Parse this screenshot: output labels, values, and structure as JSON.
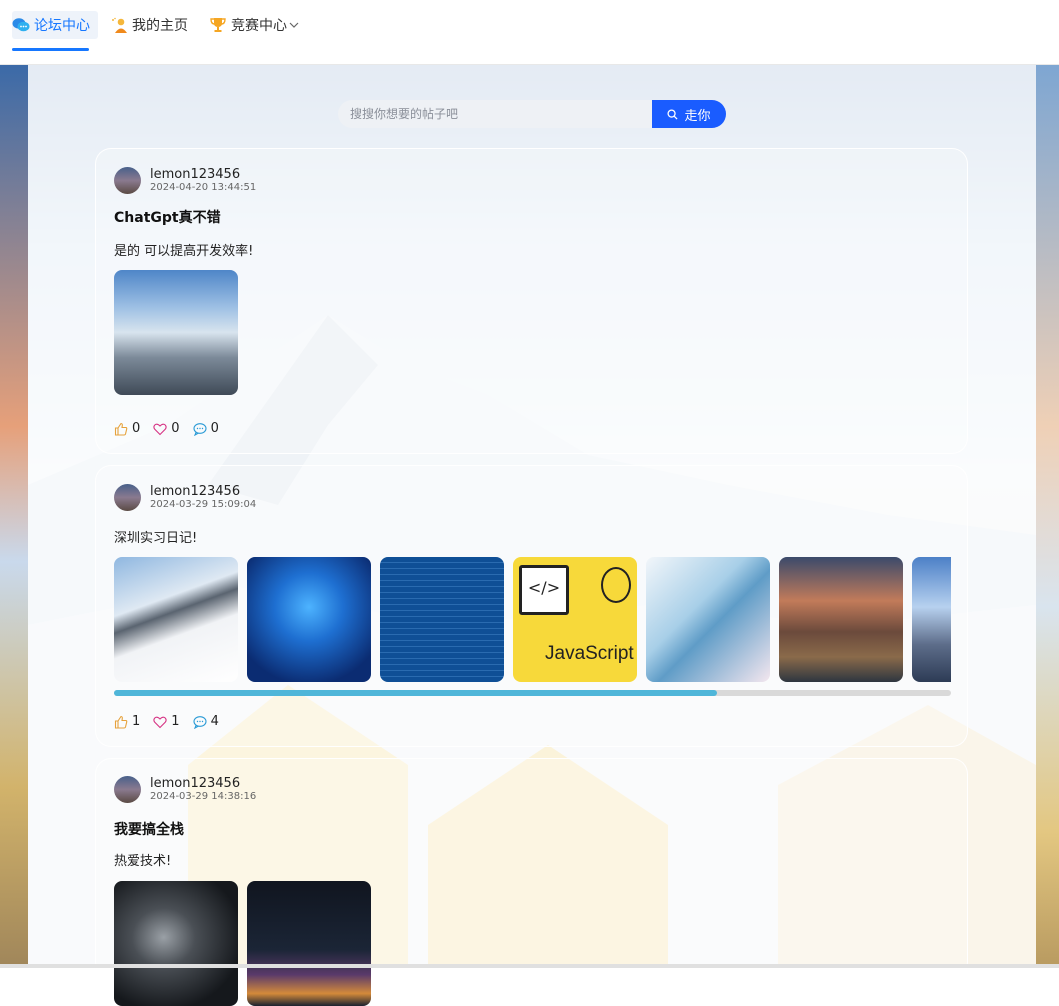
{
  "nav": {
    "items": [
      {
        "label": "论坛中心",
        "icon": "chat-bubbles-icon",
        "active": true
      },
      {
        "label": "我的主页",
        "icon": "user-person-icon",
        "active": false
      },
      {
        "label": "竞赛中心",
        "icon": "trophy-icon",
        "active": false,
        "dropdown": true
      }
    ]
  },
  "search": {
    "placeholder": "搜搜你想要的帖子吧",
    "value": "",
    "button_label": "走你"
  },
  "colors": {
    "accent": "#1677ff",
    "search_button": "#1a5cff",
    "progress": "#4fb6d9",
    "like": "#e6a23c",
    "favorite": "#d63384",
    "comment": "#2b9bd6"
  },
  "posts": [
    {
      "author": "lemon123456",
      "time": "2024-04-20 13:44:51",
      "title": "ChatGpt真不错",
      "content": "是的 可以提高开发效率!",
      "images": [
        "beach-clouds-photo"
      ],
      "likes": "0",
      "favorites": "0",
      "comments": "0"
    },
    {
      "author": "lemon123456",
      "time": "2024-03-29 15:09:04",
      "title": "",
      "content": "深圳实习日记!",
      "images": [
        "snow-mountain-hikers-photo",
        "hacker-blue-code-image",
        "code-list-poster-image",
        "javascript-logo-image",
        "blue-feather-image",
        "city-river-sunset-photo",
        "anime-sky-landscape-image"
      ],
      "thumb_caption": "JavaScript",
      "scroll_progress": 0.72,
      "likes": "1",
      "favorites": "1",
      "comments": "4"
    },
    {
      "author": "lemon123456",
      "time": "2024-03-29 14:38:16",
      "title": "我要搞全栈",
      "content": "热爱技术!",
      "images": [
        "dark-smoke-abstract-image",
        "night-city-skyline-photo"
      ]
    }
  ]
}
